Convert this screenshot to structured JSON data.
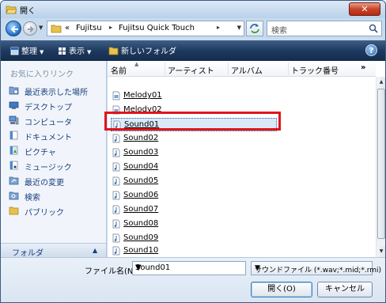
{
  "window": {
    "title": "開く",
    "close_label": "✕"
  },
  "address": {
    "prefix": "«",
    "crumbs": [
      "Fujitsu",
      "Fujitsu Quick Touch"
    ],
    "separator": "▸",
    "search_placeholder": "検索"
  },
  "toolbar": {
    "organize": "整理",
    "view": "表示",
    "new_folder": "新しいフォルダ",
    "help": "?"
  },
  "sidebar": {
    "favorites_title": "お気に入りリンク",
    "items": [
      {
        "label": "最近表示した場所",
        "icon": "recent-places-icon"
      },
      {
        "label": "デスクトップ",
        "icon": "desktop-icon"
      },
      {
        "label": "コンピュータ",
        "icon": "computer-icon"
      },
      {
        "label": "ドキュメント",
        "icon": "documents-icon"
      },
      {
        "label": "ピクチャ",
        "icon": "pictures-icon"
      },
      {
        "label": "ミュージック",
        "icon": "music-icon"
      },
      {
        "label": "最近の変更",
        "icon": "recently-changed-icon"
      },
      {
        "label": "検索",
        "icon": "searches-icon"
      },
      {
        "label": "パブリック",
        "icon": "public-folder-icon"
      }
    ],
    "folders_label": "フォルダ"
  },
  "file_list": {
    "columns": [
      "名前",
      "アーティスト",
      "アルバム",
      "トラック番号"
    ],
    "more": "»",
    "files": [
      {
        "name": "Melody01",
        "icon": "midi-file-icon"
      },
      {
        "name": "Melody02",
        "icon": "midi-file-icon"
      },
      {
        "name": "Sound01",
        "icon": "audio-file-icon",
        "selected": true
      },
      {
        "name": "Sound02",
        "icon": "audio-file-icon"
      },
      {
        "name": "Sound03",
        "icon": "audio-file-icon"
      },
      {
        "name": "Sound04",
        "icon": "audio-file-icon"
      },
      {
        "name": "Sound05",
        "icon": "audio-file-icon"
      },
      {
        "name": "Sound06",
        "icon": "audio-file-icon"
      },
      {
        "name": "Sound07",
        "icon": "audio-file-icon"
      },
      {
        "name": "Sound08",
        "icon": "audio-file-icon"
      },
      {
        "name": "Sound09",
        "icon": "audio-file-icon"
      },
      {
        "name": "Sound10",
        "icon": "audio-file-icon"
      }
    ]
  },
  "bottom": {
    "filename_label": "ファイル名(N):",
    "filename_value": "Sound01",
    "filetype_value": "サウンドファイル (*.wav;*.mid;*.rmi)",
    "open_button": "開く(O)",
    "cancel_button": "キャンセル"
  },
  "colors": {
    "highlight_frame": "#e0151c",
    "toolbar": "#1e3a5f",
    "link_text": "#1a3e7c"
  }
}
